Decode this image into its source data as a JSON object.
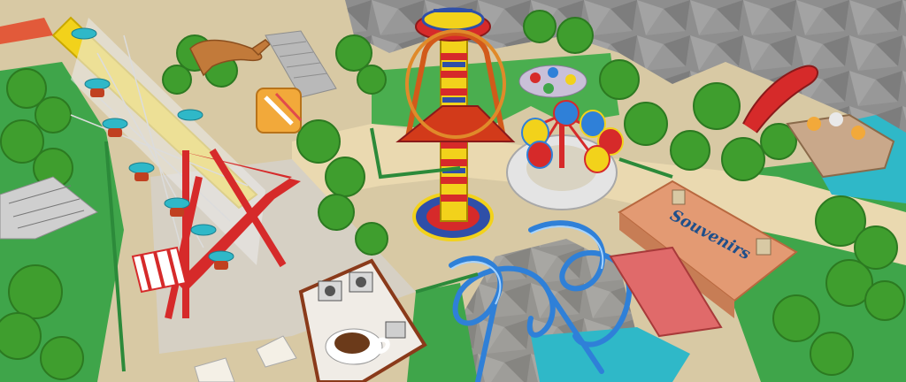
{
  "scene": {
    "description_label": "",
    "shop_sign": "Souvenirs",
    "colors": {
      "path": "#e9d9b2",
      "grass": "#3fa54a",
      "rock": "#8f8f8f",
      "water": "#2fb8c8",
      "coaster_track": "#2f80d8",
      "tower_yellow": "#f2d21b",
      "tower_red": "#d62a2a",
      "roof_salmon": "#e39a73",
      "tree": "#3f9e2e"
    },
    "icons": [
      "ferris-wheel-icon",
      "drop-tower-icon",
      "swing-ride-icon",
      "roller-coaster-icon",
      "coffee-cup-icon",
      "dinosaur-icon"
    ]
  }
}
